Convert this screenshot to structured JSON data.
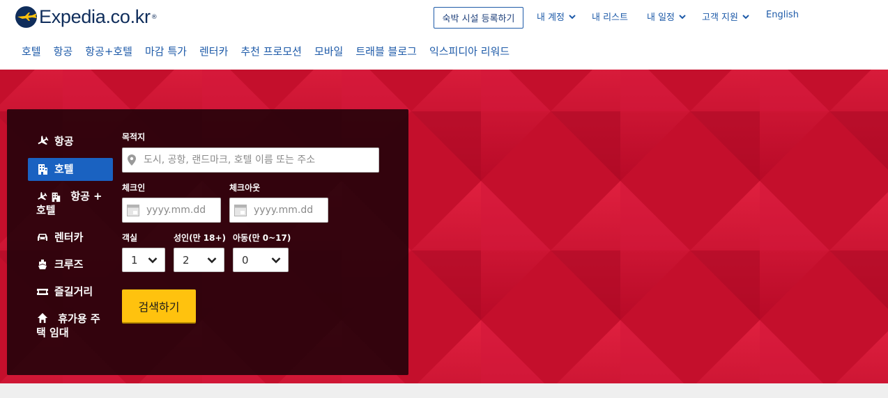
{
  "brand": {
    "name": "Expedia.co.kr",
    "tm": "®",
    "color": "#0f2d5b"
  },
  "top_nav": {
    "register": "숙박 시설 등록하기",
    "my_account": "내 계정",
    "my_list": "내 리스트",
    "my_trips": "내 일정",
    "support": "고객 지원",
    "language": "English"
  },
  "main_nav": [
    "호텔",
    "항공",
    "항공+호텔",
    "마감 특가",
    "렌터카",
    "추천 프로모션",
    "모바일",
    "트래블 블로그",
    "익스피디아 리워드"
  ],
  "sidebar": {
    "items": [
      {
        "label": "항공",
        "icon": "plane-icon"
      },
      {
        "label": "호텔",
        "icon": "building-icon",
        "active": true
      },
      {
        "label": "항공 + 호텔",
        "icon": "plane-building-icon"
      },
      {
        "label": "렌터카",
        "icon": "car-icon"
      },
      {
        "label": "크루즈",
        "icon": "cruise-icon"
      },
      {
        "label": "즐길거리",
        "icon": "ticket-icon"
      },
      {
        "label": "휴가용 주택 임대",
        "icon": "house-icon"
      }
    ]
  },
  "form": {
    "destination_label": "목적지",
    "destination_placeholder": "도시, 공항, 랜드마크, 호텔 이름 또는 주소",
    "checkin_label": "체크인",
    "checkin_placeholder": "yyyy.mm.dd",
    "checkout_label": "체크아웃",
    "checkout_placeholder": "yyyy.mm.dd",
    "rooms_label": "객실",
    "rooms_value": "1",
    "adults_label": "성인(만 18+)",
    "adults_value": "2",
    "children_label": "아동(만 0~17)",
    "children_value": "0",
    "search_button": "검색하기"
  },
  "colors": {
    "link": "#1d5aa8",
    "hero": "#c8102e",
    "active_tab": "#1a62c1",
    "search_button": "#ffc20e"
  }
}
